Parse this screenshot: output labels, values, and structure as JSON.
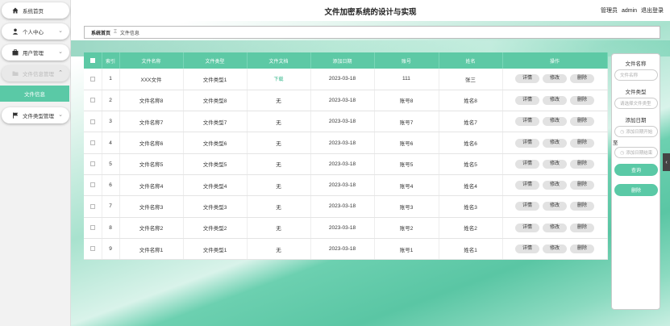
{
  "app": {
    "title": "文件加密系统的设计与实现",
    "role": "管理员",
    "username": "admin",
    "logout": "退出登录"
  },
  "sidebar": {
    "items": [
      {
        "label": "系统首页",
        "icon": "home-icon"
      },
      {
        "label": "个人中心",
        "icon": "user-icon"
      },
      {
        "label": "用户管理",
        "icon": "briefcase-icon"
      },
      {
        "label": "文件信息管理",
        "icon": "folder-icon"
      },
      {
        "label": "文件类型管理",
        "icon": "flag-icon"
      }
    ],
    "sub_active": "文件信息"
  },
  "breadcrumb": {
    "home": "系统首页",
    "separator": "Ξ",
    "current": "文件信息"
  },
  "table": {
    "headers": [
      "",
      "索引",
      "文件名称",
      "文件类型",
      "文件文档",
      "添加日期",
      "账号",
      "姓名",
      "操作"
    ],
    "rows": [
      {
        "idx": "1",
        "name": "XXX文件",
        "type": "文件类型1",
        "doc": "下载",
        "date": "2023-03-18",
        "account": "111",
        "person": "张三"
      },
      {
        "idx": "2",
        "name": "文件名称8",
        "type": "文件类型8",
        "doc": "无",
        "date": "2023-03-18",
        "account": "账号8",
        "person": "姓名8"
      },
      {
        "idx": "3",
        "name": "文件名称7",
        "type": "文件类型7",
        "doc": "无",
        "date": "2023-03-18",
        "account": "账号7",
        "person": "姓名7"
      },
      {
        "idx": "4",
        "name": "文件名称6",
        "type": "文件类型6",
        "doc": "无",
        "date": "2023-03-18",
        "account": "账号6",
        "person": "姓名6"
      },
      {
        "idx": "5",
        "name": "文件名称5",
        "type": "文件类型5",
        "doc": "无",
        "date": "2023-03-18",
        "account": "账号5",
        "person": "姓名5"
      },
      {
        "idx": "6",
        "name": "文件名称4",
        "type": "文件类型4",
        "doc": "无",
        "date": "2023-03-18",
        "account": "账号4",
        "person": "姓名4"
      },
      {
        "idx": "7",
        "name": "文件名称3",
        "type": "文件类型3",
        "doc": "无",
        "date": "2023-03-18",
        "account": "账号3",
        "person": "姓名3"
      },
      {
        "idx": "8",
        "name": "文件名称2",
        "type": "文件类型2",
        "doc": "无",
        "date": "2023-03-18",
        "account": "账号2",
        "person": "姓名2"
      },
      {
        "idx": "9",
        "name": "文件名称1",
        "type": "文件类型1",
        "doc": "无",
        "date": "2023-03-18",
        "account": "账号1",
        "person": "姓名1"
      }
    ],
    "actions": {
      "detail": "详情",
      "edit": "修改",
      "delete": "删除"
    }
  },
  "search": {
    "name_label": "文件名称",
    "name_placeholder": "文件名称",
    "type_label": "文件类型",
    "type_placeholder": "请选择文件类型",
    "date_label": "添加日期",
    "date_start_placeholder": "添加日期开始",
    "date_to": "至",
    "date_end_placeholder": "添加日期结束",
    "query_button": "查询",
    "delete_button": "删除"
  },
  "colors": {
    "accent": "#5ac9a6"
  }
}
